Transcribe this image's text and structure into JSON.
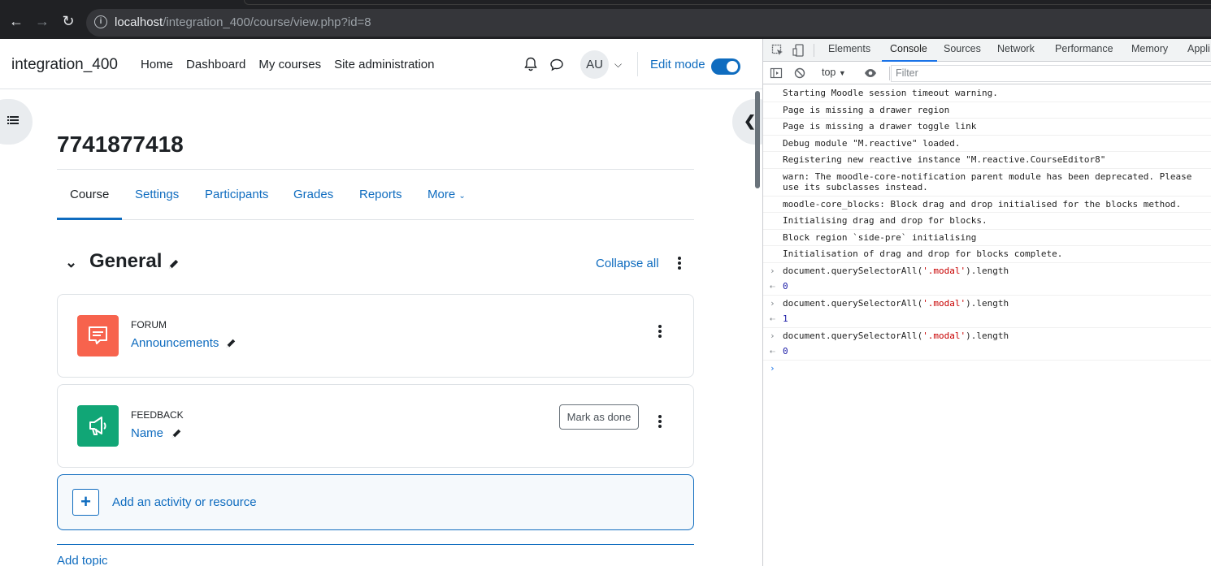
{
  "browser": {
    "url_host": "localhost",
    "url_path": "/integration_400/course/view.php?id=8"
  },
  "moodle": {
    "site_name": "integration_400",
    "primary_nav": [
      "Home",
      "Dashboard",
      "My courses",
      "Site administration"
    ],
    "user_initials": "AU",
    "edit_mode_label": "Edit mode",
    "edit_mode_on": true,
    "course_title": "7741877418",
    "secondary_nav": {
      "course": "Course",
      "settings": "Settings",
      "participants": "Participants",
      "grades": "Grades",
      "reports": "Reports",
      "more": "More"
    },
    "section": {
      "title": "General",
      "collapse_all": "Collapse all"
    },
    "activities": [
      {
        "type": "FORUM",
        "name": "Announcements",
        "icon": "forum-icon",
        "color": "#f7634d"
      },
      {
        "type": "FEEDBACK",
        "name": "Name",
        "icon": "megaphone-icon",
        "color": "#11a676",
        "mark_as_done": "Mark as done"
      }
    ],
    "add_activity_label": "Add an activity or resource",
    "add_topic_label": "Add topic",
    "accent_color": "#0f6cbf"
  },
  "devtools": {
    "tabs": [
      "Elements",
      "Console",
      "Sources",
      "Network",
      "Performance",
      "Memory",
      "Appli"
    ],
    "active_tab": "Console",
    "context": "top",
    "filter_placeholder": "Filter",
    "messages": [
      "Starting Moodle session timeout warning.",
      "Page is missing a drawer region",
      "Page is missing a drawer toggle link",
      "Debug module \"M.reactive\" loaded.",
      "Registering new reactive instance \"M.reactive.CourseEditor8\"",
      "warn: The moodle-core-notification parent module has been deprecated. Please use its subclasses instead.",
      "moodle-core_blocks: Block drag and drop initialised for the blocks method.",
      "Initialising drag and drop for blocks.",
      "Block region `side-pre` initialising",
      "Initialisation of drag and drop for blocks complete."
    ],
    "commands": [
      {
        "input_prefix": "document.querySelectorAll(",
        "input_string": "'.modal'",
        "input_suffix": ").length",
        "result": "0"
      },
      {
        "input_prefix": "document.querySelectorAll(",
        "input_string": "'.modal'",
        "input_suffix": ").length",
        "result": "1"
      },
      {
        "input_prefix": "document.querySelectorAll(",
        "input_string": "'.modal'",
        "input_suffix": ").length",
        "result": "0"
      }
    ]
  }
}
